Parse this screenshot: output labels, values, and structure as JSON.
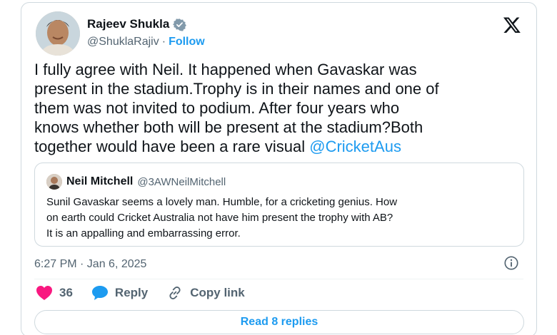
{
  "author": {
    "name": "Rajeev Shukla",
    "handle": "@ShuklaRajiv",
    "separator": "·",
    "follow_label": "Follow"
  },
  "tweet": {
    "text": "I fully agree with Neil. It happened when Gavaskar was\npresent in the stadium.Trophy is in their names and one of\nthem was not invited to podium. After four years who\nknows whether both will be present at the stadium?Both\ntogether would have been a rare visual ",
    "mention": "@CricketAus"
  },
  "quoted": {
    "name": "Neil Mitchell",
    "handle": "@3AWNeilMitchell",
    "text": "Sunil Gavaskar seems a lovely man. Humble, for a cricketing genius. How\non earth could Cricket Australia not have him present the trophy with AB?\nIt is an appalling and embarrassing error."
  },
  "meta": {
    "timestamp": "6:27 PM · Jan 6, 2025"
  },
  "actions": {
    "like_count": "36",
    "reply_label": "Reply",
    "copy_link_label": "Copy link"
  },
  "read_replies_label": "Read 8 replies",
  "icons": {
    "verified": "verified-badge-icon",
    "logo": "x-logo-icon",
    "info": "info-icon",
    "like": "heart-icon",
    "reply": "speech-bubble-icon",
    "copy": "link-icon"
  },
  "colors": {
    "accent": "#1d9bf0",
    "like": "#f91880",
    "text": "#0f1419",
    "muted": "#536471",
    "border": "#cfd9de",
    "verified": "#829aab"
  }
}
